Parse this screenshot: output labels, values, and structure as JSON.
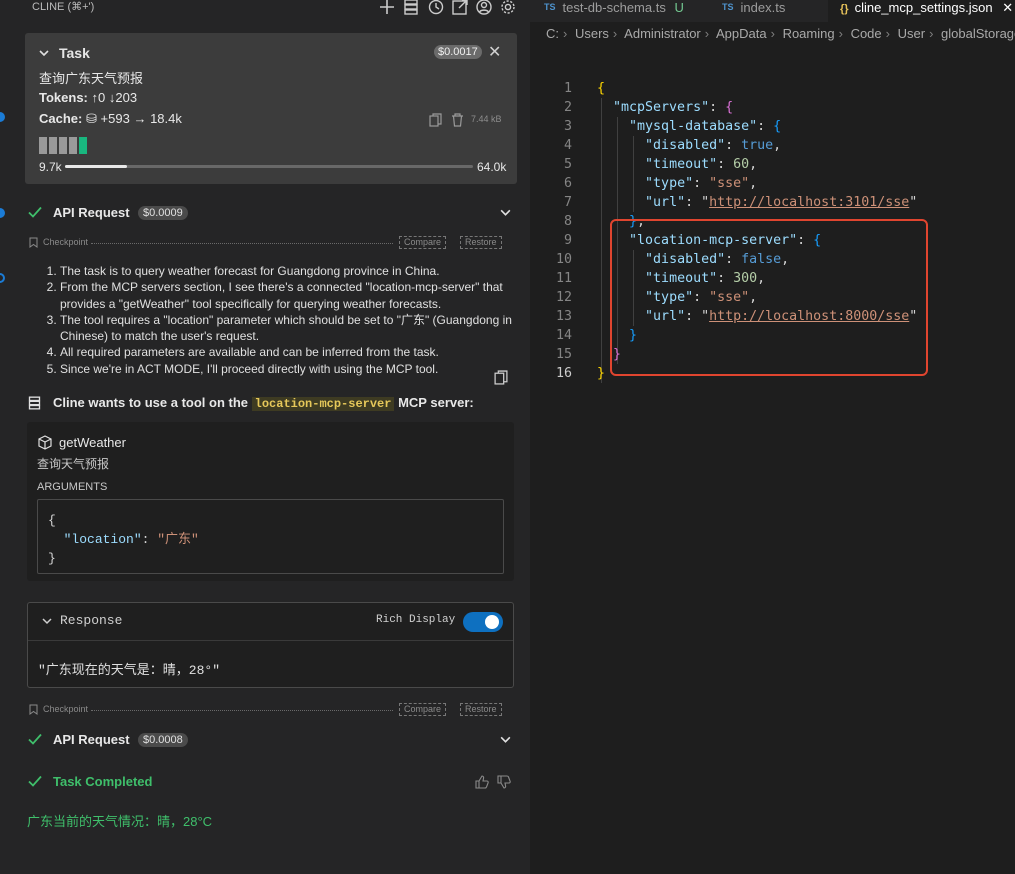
{
  "left_panel": {
    "title": "CLINE (⌘+')",
    "toolbar_icons": [
      "plus-icon",
      "server-icon",
      "history-icon",
      "popout-icon",
      "account-icon",
      "gear-icon"
    ],
    "task": {
      "label": "Task",
      "cost": "$0.0017",
      "description": "查询广东天气预报",
      "tokens_label": "Tokens:",
      "tokens_up": "0",
      "tokens_down": "203",
      "cache_label": "Cache:",
      "cache_write": "+593",
      "cache_read": "18.4k",
      "size": "7.44 kB",
      "context_start": "9.7k",
      "context_end": "64.0k",
      "context_fraction": 0.152
    },
    "api_request_1": {
      "label": "API Request",
      "cost": "$0.0009"
    },
    "checkpoint_1": {
      "label": "Checkpoint",
      "compare": "Compare",
      "restore": "Restore"
    },
    "reasoning": [
      "The task is to query weather forecast for Guangdong province in China.",
      "From the MCP servers section, I see there's a connected \"location-mcp-server\" that provides a \"getWeather\" tool specifically for querying weather forecasts.",
      "The tool requires a \"location\" parameter which should be set to \"广东\" (Guangdong in Chinese) to match the user's request.",
      "All required parameters are available and can be inferred from the task.",
      "Since we're in ACT MODE, I'll proceed directly with using the MCP tool."
    ],
    "mcp_use": {
      "prefix": "Cline wants to use a tool on the",
      "server": "location-mcp-server",
      "suffix": "MCP server:"
    },
    "tool": {
      "name": "getWeather",
      "description": "查询天气预报",
      "arguments_label": "ARGUMENTS",
      "arg_open": "{",
      "arg_key": "\"location\"",
      "arg_colon": ": ",
      "arg_value": "\"广东\"",
      "arg_close": "}"
    },
    "response": {
      "title": "Response",
      "rich_display_label": "Rich Display",
      "rich_display_on": true,
      "text": "\"广东现在的天气是：晴，28°\""
    },
    "checkpoint_2": {
      "label": "Checkpoint",
      "compare": "Compare",
      "restore": "Restore"
    },
    "api_request_2": {
      "label": "API Request",
      "cost": "$0.0008"
    },
    "task_completed": {
      "label": "Task Completed"
    },
    "final_answer": "广东当前的天气情况：晴，28°C"
  },
  "editor": {
    "tabs": [
      {
        "lang": "TS",
        "label": "test-db-schema.ts",
        "status": "U"
      },
      {
        "lang": "TS",
        "label": "index.ts"
      },
      {
        "lang": "{}",
        "label": "cline_mcp_settings.json",
        "close": "✕"
      }
    ],
    "breadcrumb": [
      "C:",
      "Users",
      "Administrator",
      "AppData",
      "Roaming",
      "Code",
      "User",
      "globalStorage"
    ],
    "lines": [
      {
        "n": "1",
        "cur": false,
        "t": "{"
      },
      {
        "n": "2",
        "t": "  \"mcpServers\": {"
      },
      {
        "n": "3",
        "t": "    \"mysql-database\": {"
      },
      {
        "n": "4",
        "t": "      \"disabled\": true,"
      },
      {
        "n": "5",
        "t": "      \"timeout\": 60,"
      },
      {
        "n": "6",
        "t": "      \"type\": \"sse\","
      },
      {
        "n": "7",
        "t": "      \"url\": \"http://localhost:3101/sse\""
      },
      {
        "n": "8",
        "t": "    },"
      },
      {
        "n": "9",
        "t": "    \"location-mcp-server\": {"
      },
      {
        "n": "10",
        "t": "      \"disabled\": false,"
      },
      {
        "n": "11",
        "t": "      \"timeout\": 300,"
      },
      {
        "n": "12",
        "t": "      \"type\": \"sse\","
      },
      {
        "n": "13",
        "t": "      \"url\": \"http://localhost:8000/sse\""
      },
      {
        "n": "14",
        "t": "    }"
      },
      {
        "n": "15",
        "t": "  }"
      },
      {
        "n": "16",
        "cur": true,
        "t": "}"
      }
    ],
    "highlight_color": "#e0452f"
  }
}
